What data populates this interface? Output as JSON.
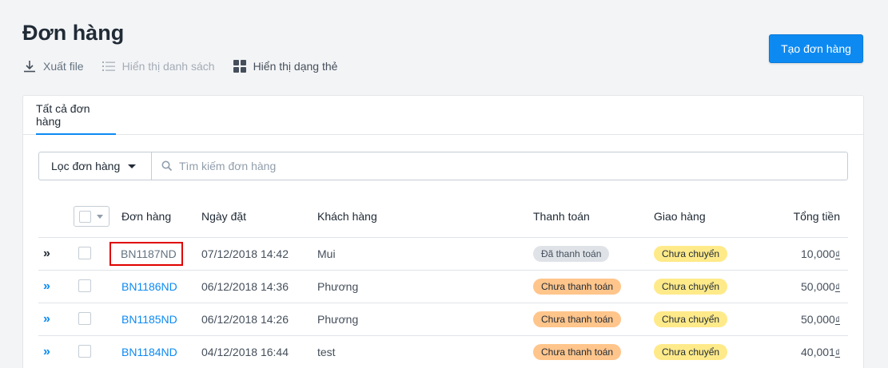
{
  "header": {
    "title": "Đơn hàng",
    "export_label": "Xuất file",
    "list_view_label": "Hiển thị danh sách",
    "card_view_label": "Hiển thị dạng thẻ",
    "create_button": "Tạo đơn hàng"
  },
  "tabs": [
    {
      "label": "Tất cả đơn hàng"
    }
  ],
  "filter": {
    "label": "Lọc đơn hàng",
    "search_placeholder": "Tìm kiếm đơn hàng"
  },
  "table": {
    "headers": {
      "order": "Đơn hàng",
      "date": "Ngày đặt",
      "customer": "Khách hàng",
      "payment": "Thanh toán",
      "shipping": "Giao hàng",
      "total": "Tổng tiền"
    },
    "rows": [
      {
        "order": "BN1187ND",
        "date": "07/12/2018 14:42",
        "customer": "Mui",
        "payment": "Đã thanh toán",
        "shipping": "Chưa chuyển",
        "total": "10,000",
        "currency": "₫"
      },
      {
        "order": "BN1186ND",
        "date": "06/12/2018 14:36",
        "customer": "Phương",
        "payment": "Chưa thanh toán",
        "shipping": "Chưa chuyển",
        "total": "50,000",
        "currency": "₫"
      },
      {
        "order": "BN1185ND",
        "date": "06/12/2018 14:26",
        "customer": "Phương",
        "payment": "Chưa thanh toán",
        "shipping": "Chưa chuyển",
        "total": "50,000",
        "currency": "₫"
      },
      {
        "order": "BN1184ND",
        "date": "04/12/2018 16:44",
        "customer": "test",
        "payment": "Chưa thanh toán",
        "shipping": "Chưa chuyển",
        "total": "40,001",
        "currency": "₫"
      }
    ]
  },
  "colors": {
    "accent": "#0c8af2",
    "highlight_outline": "#e00000",
    "badge_paid": "#dfe3e8",
    "badge_unpaid": "#ffc58b",
    "badge_shipping": "#ffea8a"
  }
}
